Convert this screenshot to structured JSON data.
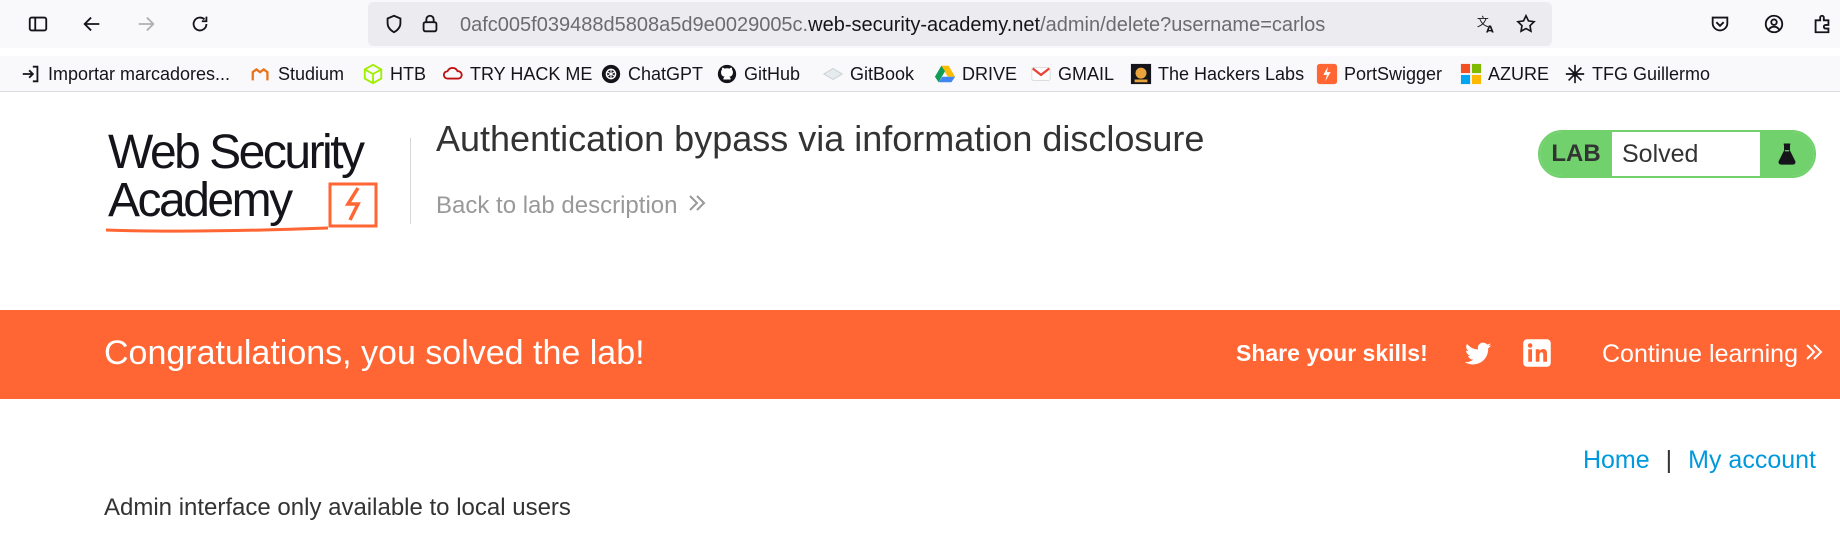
{
  "browser": {
    "url_prefix": "0afc005f039488d5808a5d9e0029005c.",
    "url_domain": "web-security-academy.net",
    "url_path": "/admin/delete?username=carlos",
    "icons": [
      "sidebar-icon",
      "back-icon",
      "forward-icon",
      "reload-icon",
      "shield-icon",
      "lock-icon",
      "translate-icon",
      "bookmark-star-icon",
      "pocket-icon",
      "account-icon",
      "extensions-icon"
    ]
  },
  "bookmarks": [
    {
      "label": "Importar marcadores...",
      "icon": "import-icon"
    },
    {
      "label": "Studium",
      "icon": "studium-icon"
    },
    {
      "label": "HTB",
      "icon": "htb-icon"
    },
    {
      "label": "TRY HACK ME",
      "icon": "tryhackme-icon"
    },
    {
      "label": "ChatGPT",
      "icon": "chatgpt-icon"
    },
    {
      "label": "GitHub",
      "icon": "github-icon"
    },
    {
      "label": "GitBook",
      "icon": "gitbook-icon"
    },
    {
      "label": "DRIVE",
      "icon": "drive-icon"
    },
    {
      "label": "GMAIL",
      "icon": "gmail-icon"
    },
    {
      "label": "The Hackers Labs",
      "icon": "hackers-labs-icon"
    },
    {
      "label": "PortSwigger",
      "icon": "portswigger-icon"
    },
    {
      "label": "AZURE",
      "icon": "azure-icon"
    },
    {
      "label": "TFG Guillermo",
      "icon": "tfg-icon"
    }
  ],
  "lab": {
    "logo_line1": "Web Security",
    "logo_line2": "Academy",
    "title": "Authentication bypass via information disclosure",
    "back_link": "Back to lab description",
    "status_tag": "LAB",
    "status_value": "Solved"
  },
  "banner": {
    "message": "Congratulations, you solved the lab!",
    "share": "Share your skills!",
    "continue": "Continue learning"
  },
  "nav": {
    "home": "Home",
    "separator": "|",
    "account": "My account"
  },
  "content": {
    "message": "Admin interface only available to local users"
  },
  "colors": {
    "accent": "#ff6633",
    "lab_green": "#70d16d",
    "link_blue": "#0099dd"
  }
}
